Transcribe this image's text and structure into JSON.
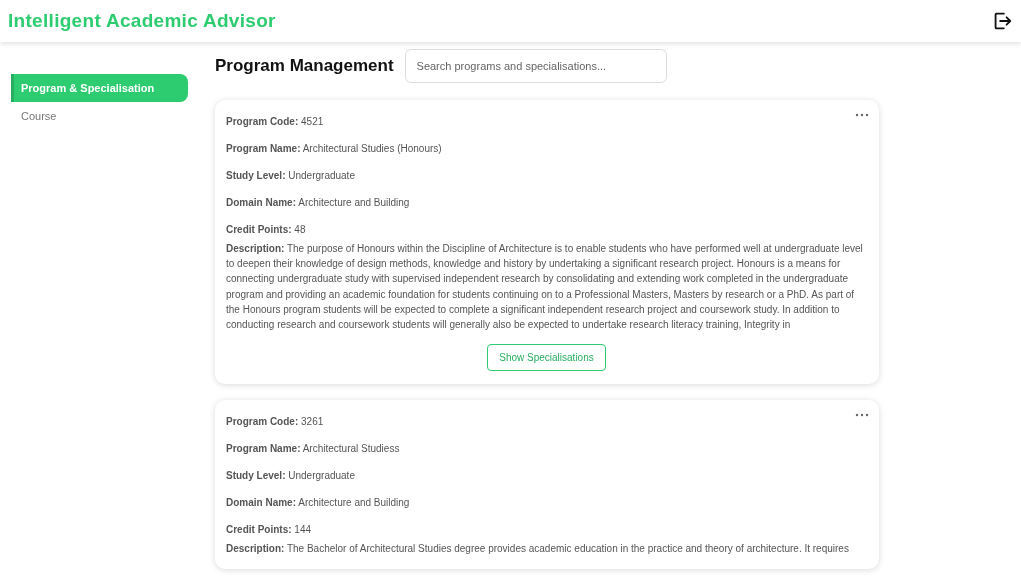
{
  "header": {
    "title": "Intelligent Academic Advisor"
  },
  "sidebar": {
    "items": [
      {
        "label": "Program & Specialisation",
        "selected": true
      },
      {
        "label": "Course",
        "selected": false
      }
    ]
  },
  "page": {
    "title": "Program Management",
    "search": {
      "placeholder": "Search programs and specialisations..."
    }
  },
  "programs": [
    {
      "fields": [
        {
          "label": "Program Code:",
          "value": "4521"
        },
        {
          "label": "Program Name:",
          "value": "Architectural Studies (Honours)"
        },
        {
          "label": "Study Level:",
          "value": "Undergraduate"
        },
        {
          "label": "Domain Name:",
          "value": "Architecture and Building"
        },
        {
          "label": "Credit Points:",
          "value": "48"
        }
      ],
      "description": {
        "label": "Description:",
        "value": "The purpose of Honours within the Discipline of Architecture is to enable students who have performed well at undergraduate level to deepen their knowledge of design methods, knowledge and history by undertaking a significant research project. Honours is a means for connecting undergraduate study with supervised independent research by consolidating and extending work completed in the undergraduate program and providing an academic foundation for students continuing on to a Professional Masters, Masters by research or a PhD. As part of the Honours program students will be expected to complete a significant independent research project and coursework study. In addition to conducting research and coursework students will generally also be expected to undertake research literacy training, Integrity in"
      },
      "button": "Show Specialisations"
    },
    {
      "fields": [
        {
          "label": "Program Code:",
          "value": "3261"
        },
        {
          "label": "Program Name:",
          "value": "Architectural Studiess"
        },
        {
          "label": "Study Level:",
          "value": "Undergraduate"
        },
        {
          "label": "Domain Name:",
          "value": "Architecture and Building"
        },
        {
          "label": "Credit Points:",
          "value": "144"
        }
      ],
      "description": {
        "label": "Description:",
        "value": "The Bachelor of Architectural Studies degree provides academic education in the practice and theory of architecture. It requires"
      }
    }
  ]
}
